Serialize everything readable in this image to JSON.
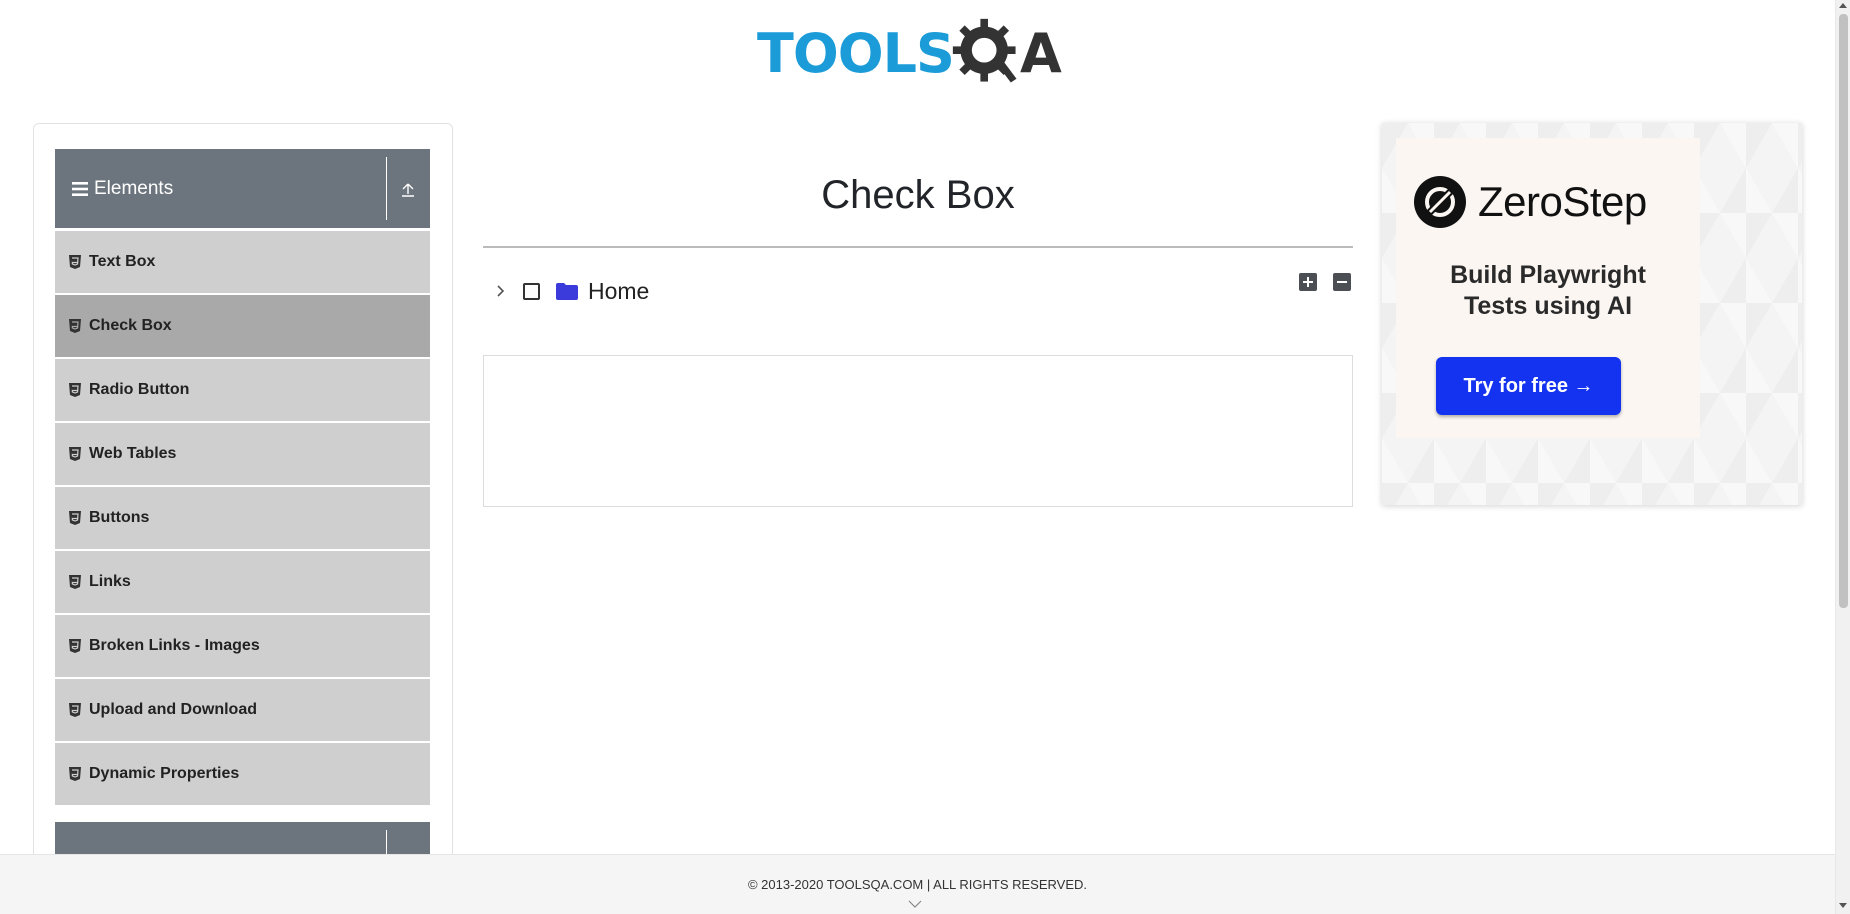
{
  "header": {
    "logo_text": "TOOLS",
    "logo_suffix": "A"
  },
  "sidebar": {
    "group_title": "Elements",
    "items": [
      {
        "label": "Text Box",
        "active": false
      },
      {
        "label": "Check Box",
        "active": true
      },
      {
        "label": "Radio Button",
        "active": false
      },
      {
        "label": "Web Tables",
        "active": false
      },
      {
        "label": "Buttons",
        "active": false
      },
      {
        "label": "Links",
        "active": false
      },
      {
        "label": "Broken Links - Images",
        "active": false
      },
      {
        "label": "Upload and Download",
        "active": false
      },
      {
        "label": "Dynamic Properties",
        "active": false
      }
    ]
  },
  "main": {
    "title": "Check Box",
    "tree": {
      "root_label": "Home",
      "expanded": false,
      "checked": false
    }
  },
  "ad": {
    "brand": "ZeroStep",
    "tagline_line1": "Build Playwright",
    "tagline_line2": "Tests using AI",
    "cta": "Try for free →"
  },
  "footer": {
    "copyright": "© 2013-2020 TOOLSQA.COM | ALL RIGHTS RESERVED."
  },
  "colors": {
    "brand_blue": "#1b9cd8",
    "sidebar_header": "#6c757d",
    "menu_item": "#cfcfcf",
    "menu_item_active": "#a9a9a9",
    "folder": "#3b3bdb",
    "ad_button": "#1433f0"
  }
}
